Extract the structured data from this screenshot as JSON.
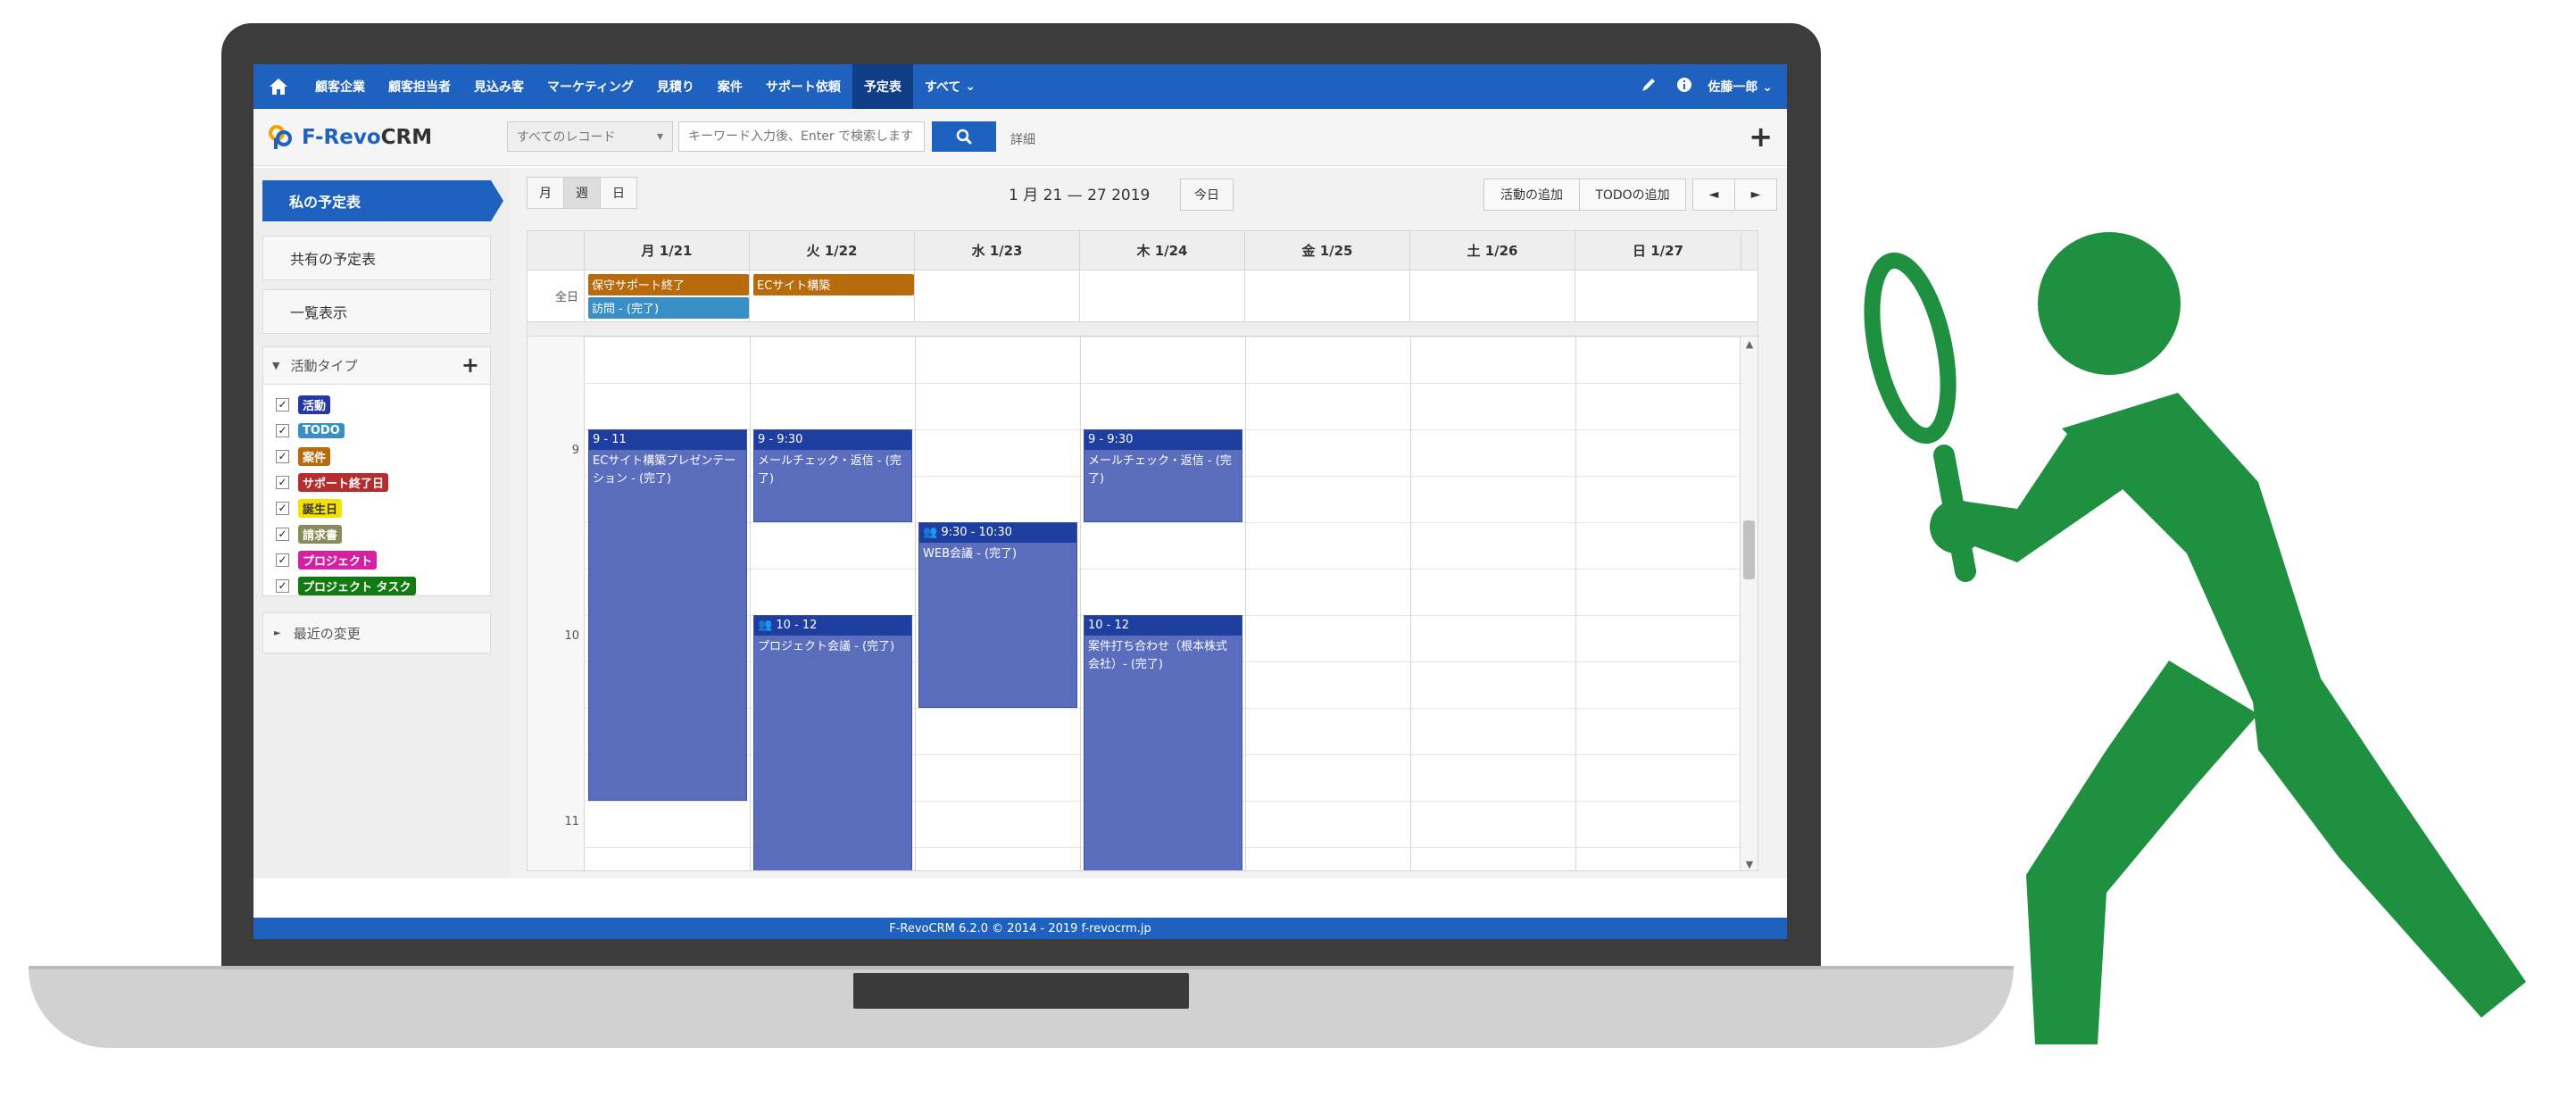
{
  "topnav": {
    "items": [
      "顧客企業",
      "顧客担当者",
      "見込み客",
      "マーケティング",
      "見積り",
      "案件",
      "サポート依頼",
      "予定表",
      "すべて"
    ],
    "active_index": 7,
    "more_caret": "⌄",
    "user": "佐藤一郎"
  },
  "header": {
    "logo_text": "F-Revo",
    "logo_text_crm": "CRM",
    "record_filter": "すべてのレコード",
    "search_placeholder": "キーワード入力後、Enter で検索します",
    "detail_label": "詳細"
  },
  "sidebar": {
    "active_item": "私の予定表",
    "items": [
      "共有の予定表",
      "一覧表示"
    ],
    "activity_type_title": "活動タイプ",
    "activity_types": [
      {
        "label": "活動",
        "color": "#2338a6"
      },
      {
        "label": "TODO",
        "color": "#3a8fc7"
      },
      {
        "label": "案件",
        "color": "#b86b0d"
      },
      {
        "label": "サポート終了日",
        "color": "#b52d2d"
      },
      {
        "label": "誕生日",
        "color": "#f2e200"
      },
      {
        "label": "請求書",
        "color": "#8a8a5a"
      },
      {
        "label": "プロジェクト",
        "color": "#d321a2"
      },
      {
        "label": "プロジェクト タスク",
        "color": "#117a11"
      }
    ],
    "recent_label": "最近の変更"
  },
  "calendar": {
    "views": [
      "月",
      "週",
      "日"
    ],
    "active_view": 1,
    "date_range": "1 月 21 — 27 2019",
    "today_label": "今日",
    "add_event_label": "活動の追加",
    "add_todo_label": "TODOの追加",
    "prev": "◄",
    "next": "►",
    "days": [
      "月 1/21",
      "火 1/22",
      "水 1/23",
      "木 1/24",
      "金 1/25",
      "土 1/26",
      "日 1/27"
    ],
    "allday_label": "全日",
    "allday_events": [
      {
        "text": "保守サポート終了",
        "color": "#b86b0d"
      },
      {
        "text": "訪問 - (完了)",
        "color": "#3a8fc7"
      },
      {
        "text": "ECサイト構築",
        "color": "#b86b0d"
      }
    ],
    "hours": [
      "9",
      "10",
      "11"
    ],
    "events": [
      {
        "time": "9 - 11",
        "title": "ECサイト構築プレゼンテーション - (完了)"
      },
      {
        "time": "9 - 9:30",
        "title": "メールチェック・返信 - (完了)"
      },
      {
        "time": "9:30 - 10:30",
        "title": "WEB会議 - (完了)"
      },
      {
        "time": "9 - 9:30",
        "title": "メールチェック・返信 - (完了)"
      },
      {
        "time": "10 - 12",
        "title": "プロジェクト会議 - (完了)"
      },
      {
        "time": "10 - 12",
        "title": "案件打ち合わせ（根本株式会社）- (完了)"
      }
    ]
  },
  "footer": {
    "text": "F-RevoCRM 6.2.0 © 2014 - 2019 f-revocrm.jp"
  },
  "colors": {
    "brand": "#1f61bf",
    "nav_active": "#0f3d86",
    "event": "#5b6dbd",
    "person_green": "#1e9040"
  },
  "icons": [
    "home-icon",
    "pen-icon",
    "info-icon",
    "search-icon",
    "plus-icon",
    "magnifying-glass-icon",
    "person-silhouette"
  ]
}
